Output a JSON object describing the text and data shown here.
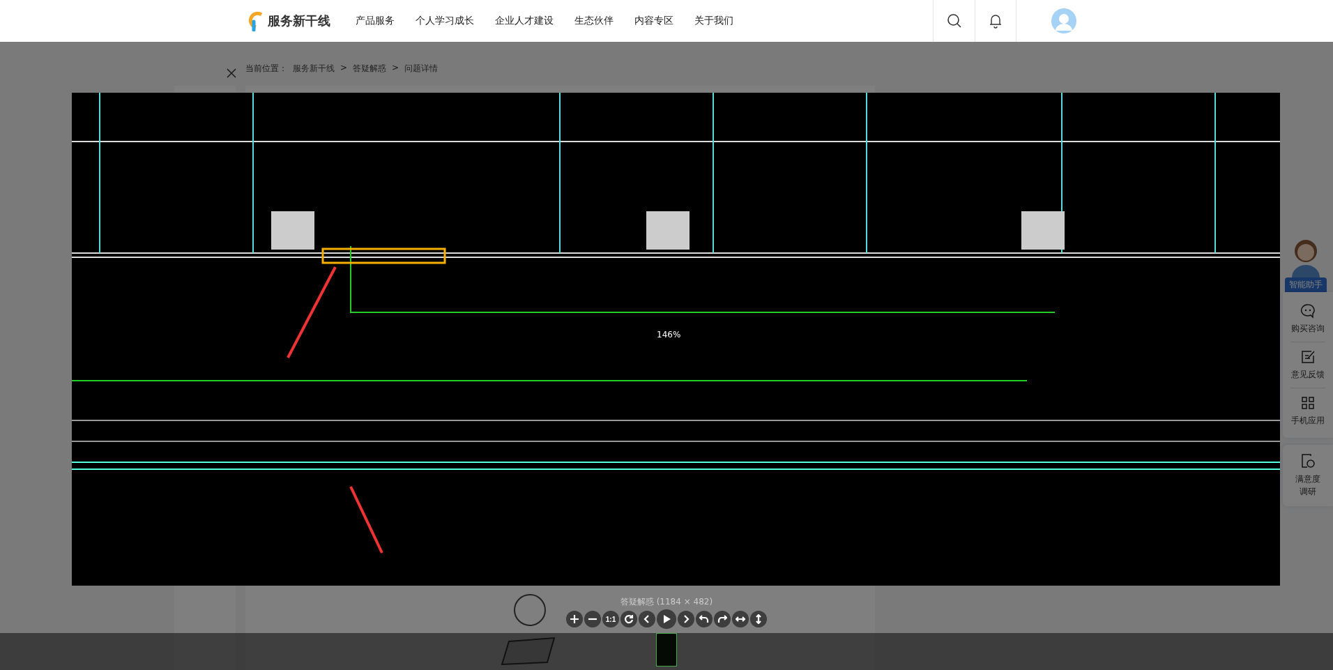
{
  "header": {
    "logo": "服务新干线",
    "nav": [
      {
        "label": "产品服务"
      },
      {
        "label": "个人学习成长"
      },
      {
        "label": "企业人才建设"
      },
      {
        "label": "生态伙伴"
      },
      {
        "label": "内容专区"
      },
      {
        "label": "关于我们"
      }
    ]
  },
  "breadcrumb": {
    "label": "当前位置：",
    "items": [
      {
        "text": "服务新干线",
        "sep": ">"
      },
      {
        "text": "答疑解惑",
        "sep": ">"
      },
      {
        "text": "问题详情"
      }
    ]
  },
  "side": {
    "assistant": "智能助手",
    "items": [
      {
        "kind": "chat",
        "label": "购买咨询"
      },
      {
        "kind": "edit",
        "label": "意见反馈"
      },
      {
        "kind": "qr",
        "label": "手机应用"
      }
    ],
    "survey": "满意度调研"
  },
  "viewer": {
    "zoom": "146%",
    "caption": "答疑解惑 (1184 × 482)",
    "tools": [
      {
        "kind": "zoom-in"
      },
      {
        "kind": "zoom-out"
      },
      {
        "kind": "actual-size",
        "label": "1:1"
      },
      {
        "kind": "reset"
      },
      {
        "kind": "prev"
      },
      {
        "kind": "play"
      },
      {
        "kind": "next"
      },
      {
        "kind": "rotate-left"
      },
      {
        "kind": "rotate-right"
      },
      {
        "kind": "flip-h"
      },
      {
        "kind": "flip-v"
      }
    ]
  }
}
